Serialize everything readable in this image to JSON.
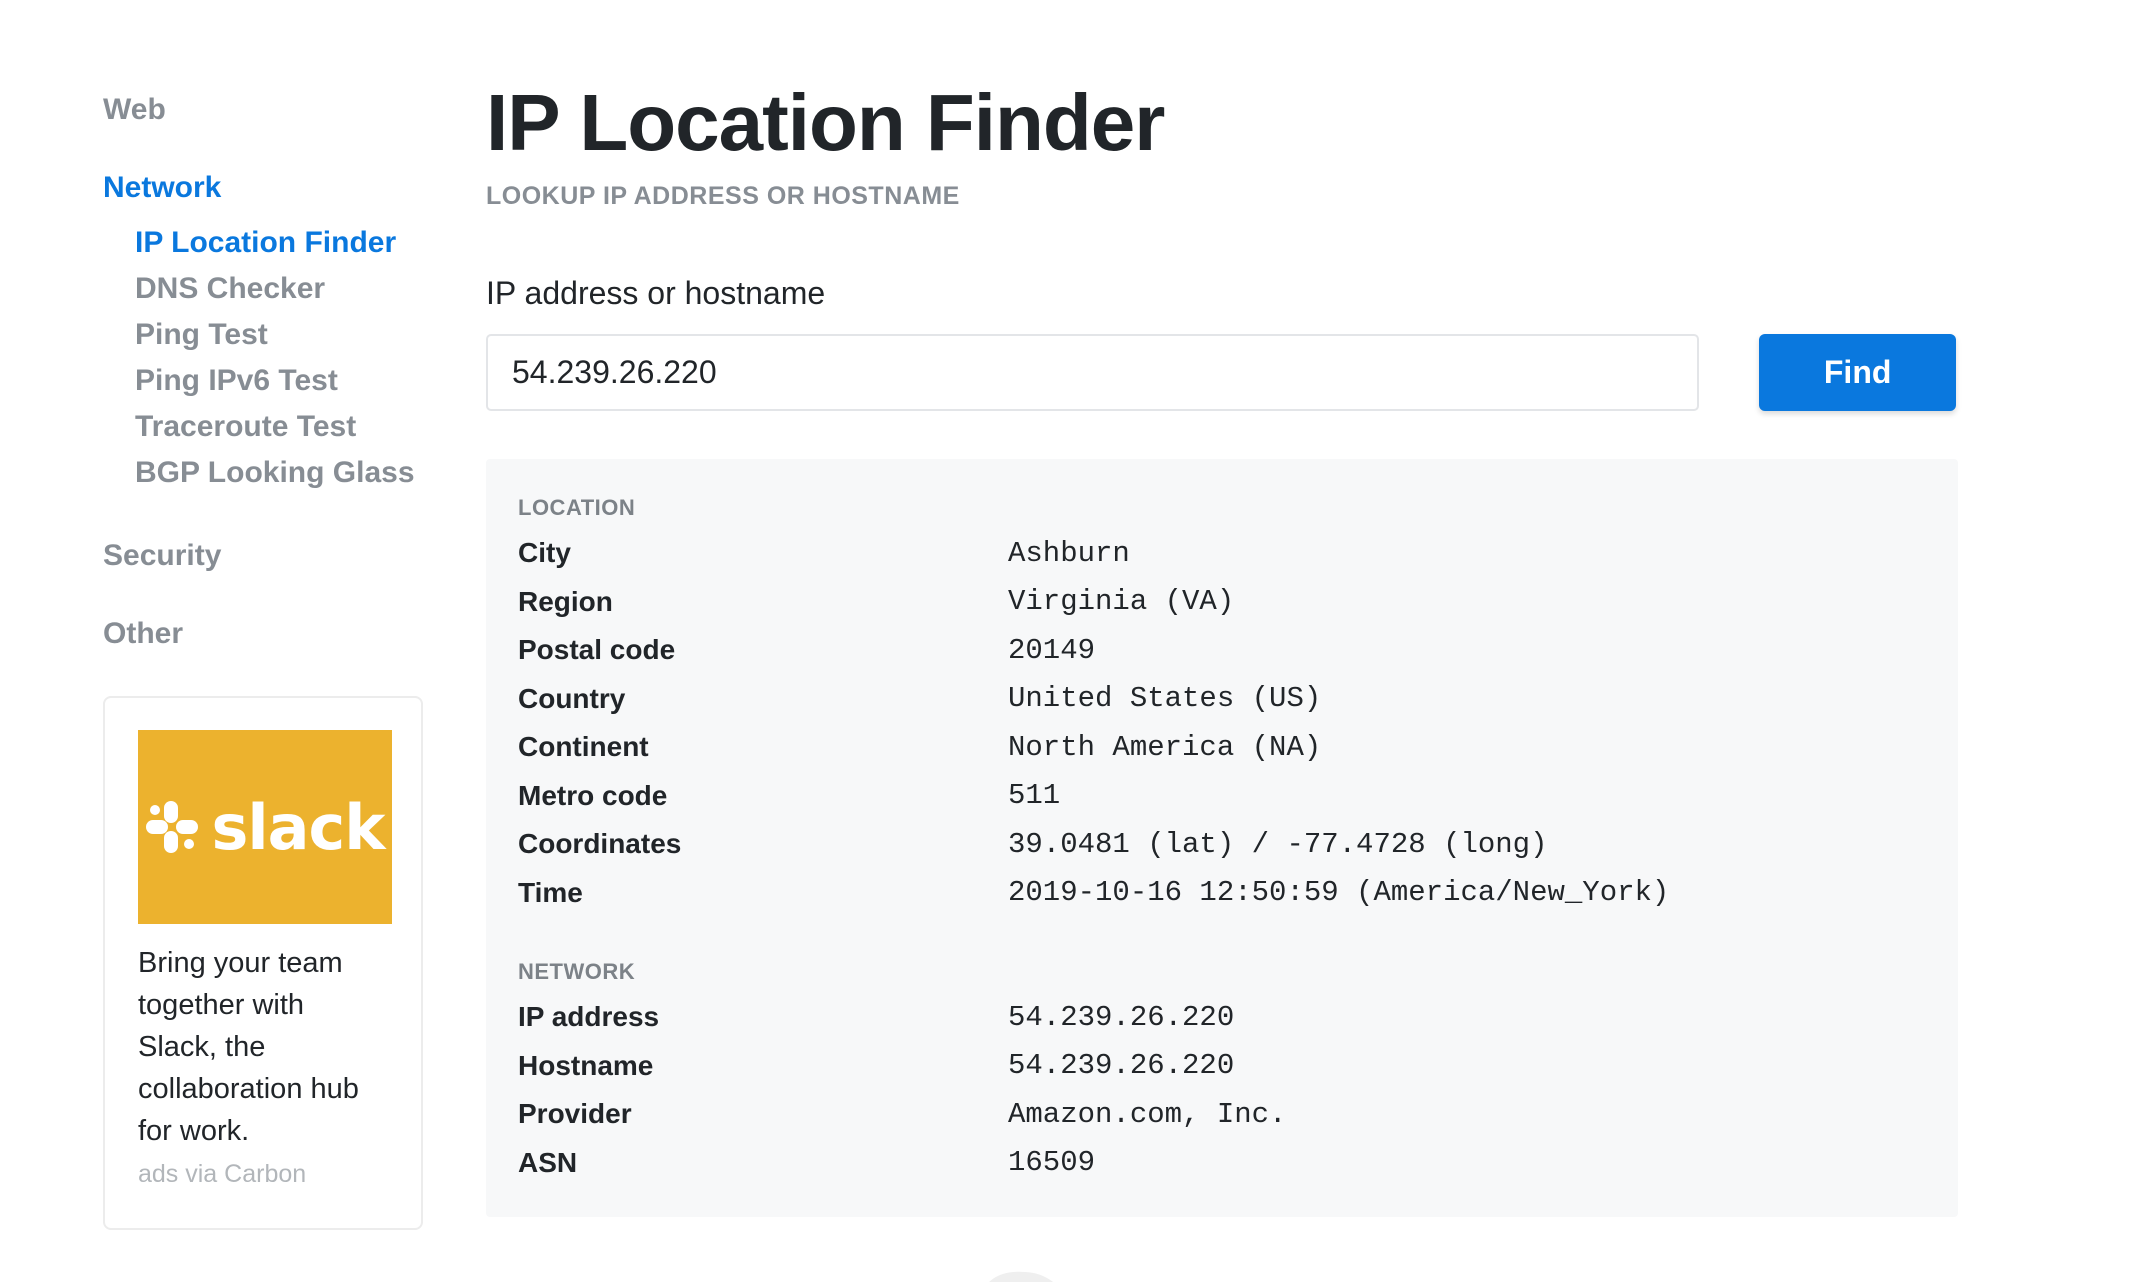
{
  "sidebar": {
    "sections": [
      {
        "label": "Web"
      },
      {
        "label": "Network"
      },
      {
        "label": "Security"
      },
      {
        "label": "Other"
      }
    ],
    "network_items": [
      {
        "label": "IP Location Finder"
      },
      {
        "label": "DNS Checker"
      },
      {
        "label": "Ping Test"
      },
      {
        "label": "Ping IPv6 Test"
      },
      {
        "label": "Traceroute Test"
      },
      {
        "label": "BGP Looking Glass"
      }
    ],
    "ad": {
      "image_label": "slack",
      "text": "Bring your team together with Slack, the collaboration hub for work.",
      "via": "ads via Carbon",
      "brand_color": "#ECB22E"
    }
  },
  "main": {
    "title": "IP Location Finder",
    "subtitle": "LOOKUP IP ADDRESS OR HOSTNAME",
    "field_label": "IP address or hostname",
    "input_value": "54.239.26.220",
    "find_label": "Find"
  },
  "results": {
    "location": {
      "heading": "LOCATION",
      "rows": [
        {
          "key": "City",
          "value": "Ashburn"
        },
        {
          "key": "Region",
          "value": "Virginia (VA)"
        },
        {
          "key": "Postal code",
          "value": "20149"
        },
        {
          "key": "Country",
          "value": "United States (US)"
        },
        {
          "key": "Continent",
          "value": "North America (NA)"
        },
        {
          "key": "Metro code",
          "value": "511"
        },
        {
          "key": "Coordinates",
          "value": "39.0481 (lat) / -77.4728 (long)"
        },
        {
          "key": "Time",
          "value": "2019-10-16 12:50:59 (America/New_York)"
        }
      ]
    },
    "network": {
      "heading": "NETWORK",
      "rows": [
        {
          "key": "IP address",
          "value": "54.239.26.220"
        },
        {
          "key": "Hostname",
          "value": "54.239.26.220"
        },
        {
          "key": "Provider",
          "value": "Amazon.com, Inc."
        },
        {
          "key": "ASN",
          "value": "16509"
        }
      ]
    }
  },
  "colors": {
    "accent": "#0A78DE",
    "muted": "#878D94",
    "panel_bg": "#F7F8F9"
  }
}
